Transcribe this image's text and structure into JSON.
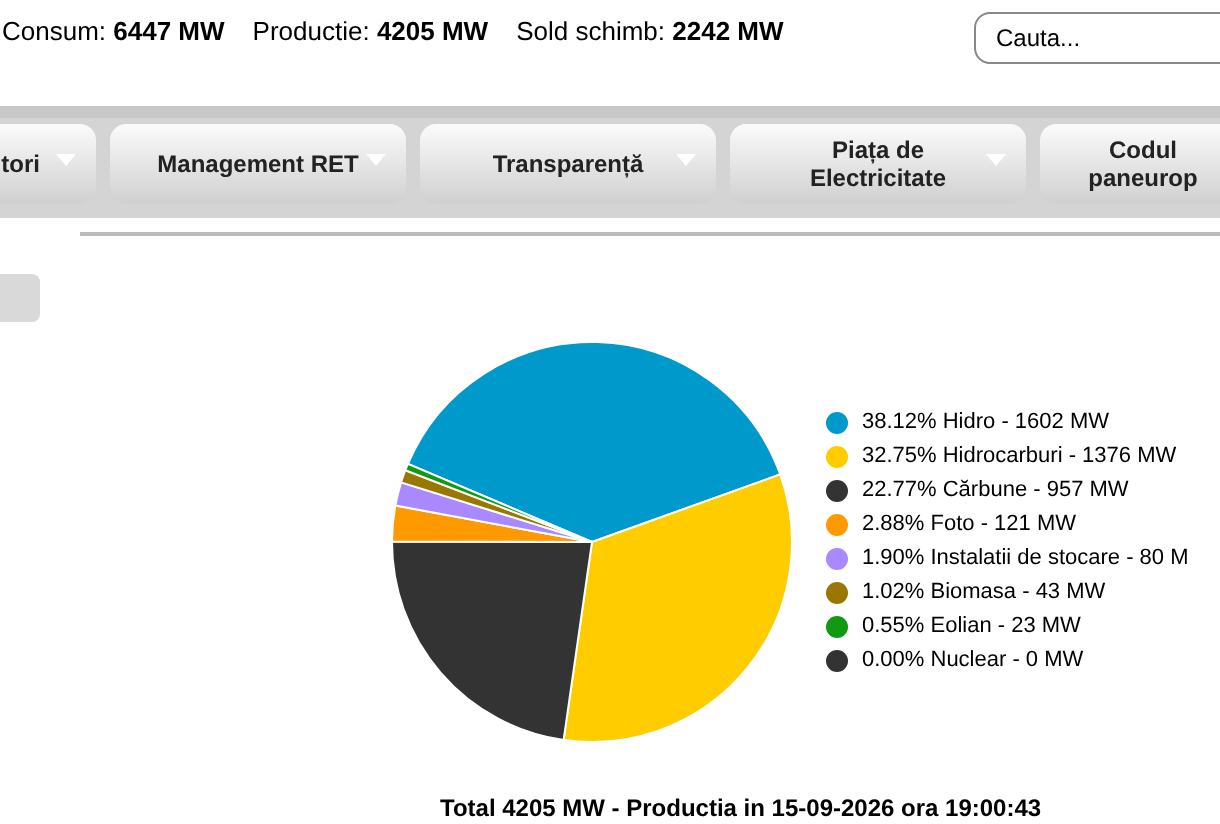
{
  "header": {
    "stats": [
      "Consum: **6447 MW**",
      "Productie: **4205 MW**",
      "Sold schimb: **2242 MW**"
    ],
    "search": {
      "placeholder": "Cauta..."
    }
  },
  "nav": {
    "items": [
      {
        "label": "tori"
      },
      {
        "label": "Management RET"
      },
      {
        "label": "Transparență"
      },
      {
        "label": "Piața de Electricitate"
      },
      {
        "label": "Codul paneurop"
      }
    ]
  },
  "production": {
    "chart_data": {
      "type": "pie",
      "categories": [
        "38.12% Hidro - 1602 MW",
        "32.75% Hidrocarburi - 1376 MW",
        "22.77% Cărbune - 957 MW",
        "2.88% Foto - 121 MW",
        "1.90% Instalatii de stocare - 80 M",
        "1.02% Biomasa - 43 MW",
        "0.55% Eolian - 23 MW",
        "0.00% Nuclear - 0 MW"
      ],
      "series": [
        {
          "values": [
            38.12,
            32.75,
            22.77,
            2.88,
            1.9,
            1.02,
            0.55,
            0.0
          ]
        }
      ]
    },
    "slices": [
      {
        "color": "#0099cc"
      },
      {
        "color": "#ffcc00"
      },
      {
        "color": "#333333"
      },
      {
        "color": "#ff9900"
      },
      {
        "color": "#aa88ff"
      },
      {
        "color": "#997700"
      },
      {
        "color": "#119911"
      },
      {
        "color": "#333333"
      }
    ],
    "caption": "Total 4205 MW - Productia in 15-09-2026 ora 19:00:43"
  }
}
